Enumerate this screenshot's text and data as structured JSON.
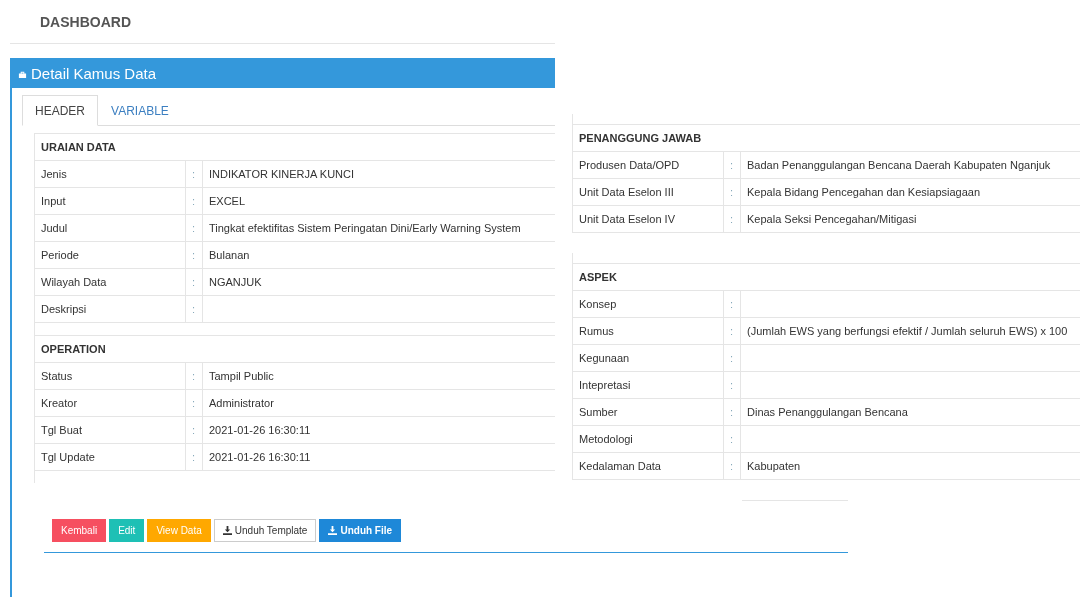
{
  "page_title": "DASHBOARD",
  "panel": {
    "title": "Detail Kamus Data"
  },
  "tabs": [
    {
      "label": "HEADER",
      "selected": true
    },
    {
      "label": "VARIABLE",
      "selected": false
    }
  ],
  "left_sections": [
    {
      "heading": "URAIAN DATA",
      "rows": [
        {
          "label": "Jenis",
          "value": "INDIKATOR KINERJA KUNCI"
        },
        {
          "label": "Input",
          "value": "EXCEL"
        },
        {
          "label": "Judul",
          "value": "Tingkat efektifitas Sistem Peringatan Dini/Early Warning System"
        },
        {
          "label": "Periode",
          "value": "Bulanan"
        },
        {
          "label": "Wilayah Data",
          "value": "NGANJUK"
        },
        {
          "label": "Deskripsi",
          "value": ""
        }
      ]
    },
    {
      "heading": "OPERATION",
      "rows": [
        {
          "label": "Status",
          "value": "Tampil Public"
        },
        {
          "label": "Kreator",
          "value": "Administrator"
        },
        {
          "label": "Tgl Buat",
          "value": "2021-01-26 16:30:11"
        },
        {
          "label": "Tgl Update",
          "value": "2021-01-26 16:30:11"
        }
      ]
    }
  ],
  "right_sections": [
    {
      "heading": "PENANGGUNG JAWAB",
      "rows": [
        {
          "label": "Produsen Data/OPD",
          "value": "Badan Penanggulangan Bencana Daerah Kabupaten Nganjuk"
        },
        {
          "label": "Unit Data Eselon III",
          "value": "Kepala Bidang Pencegahan dan Kesiapsiagaan"
        },
        {
          "label": "Unit Data Eselon IV",
          "value": "Kepala Seksi Pencegahan/Mitigasi"
        }
      ]
    },
    {
      "heading": "ASPEK",
      "rows": [
        {
          "label": "Konsep",
          "value": ""
        },
        {
          "label": "Rumus",
          "value": "(Jumlah EWS yang berfungsi efektif / Jumlah seluruh EWS) x 100"
        },
        {
          "label": "Kegunaan",
          "value": ""
        },
        {
          "label": "Intepretasi",
          "value": ""
        },
        {
          "label": "Sumber",
          "value": "Dinas Penanggulangan Bencana"
        },
        {
          "label": "Metodologi",
          "value": ""
        },
        {
          "label": "Kedalaman Data",
          "value": "Kabupaten"
        }
      ]
    }
  ],
  "colon": ":",
  "buttons": [
    {
      "label": "Kembali",
      "kind": "danger"
    },
    {
      "label": "Edit",
      "kind": "teal"
    },
    {
      "label": "View Data",
      "kind": "warning"
    },
    {
      "label": "Unduh Template",
      "kind": "outline-download"
    },
    {
      "label": "Unduh File",
      "kind": "primary-download"
    }
  ]
}
